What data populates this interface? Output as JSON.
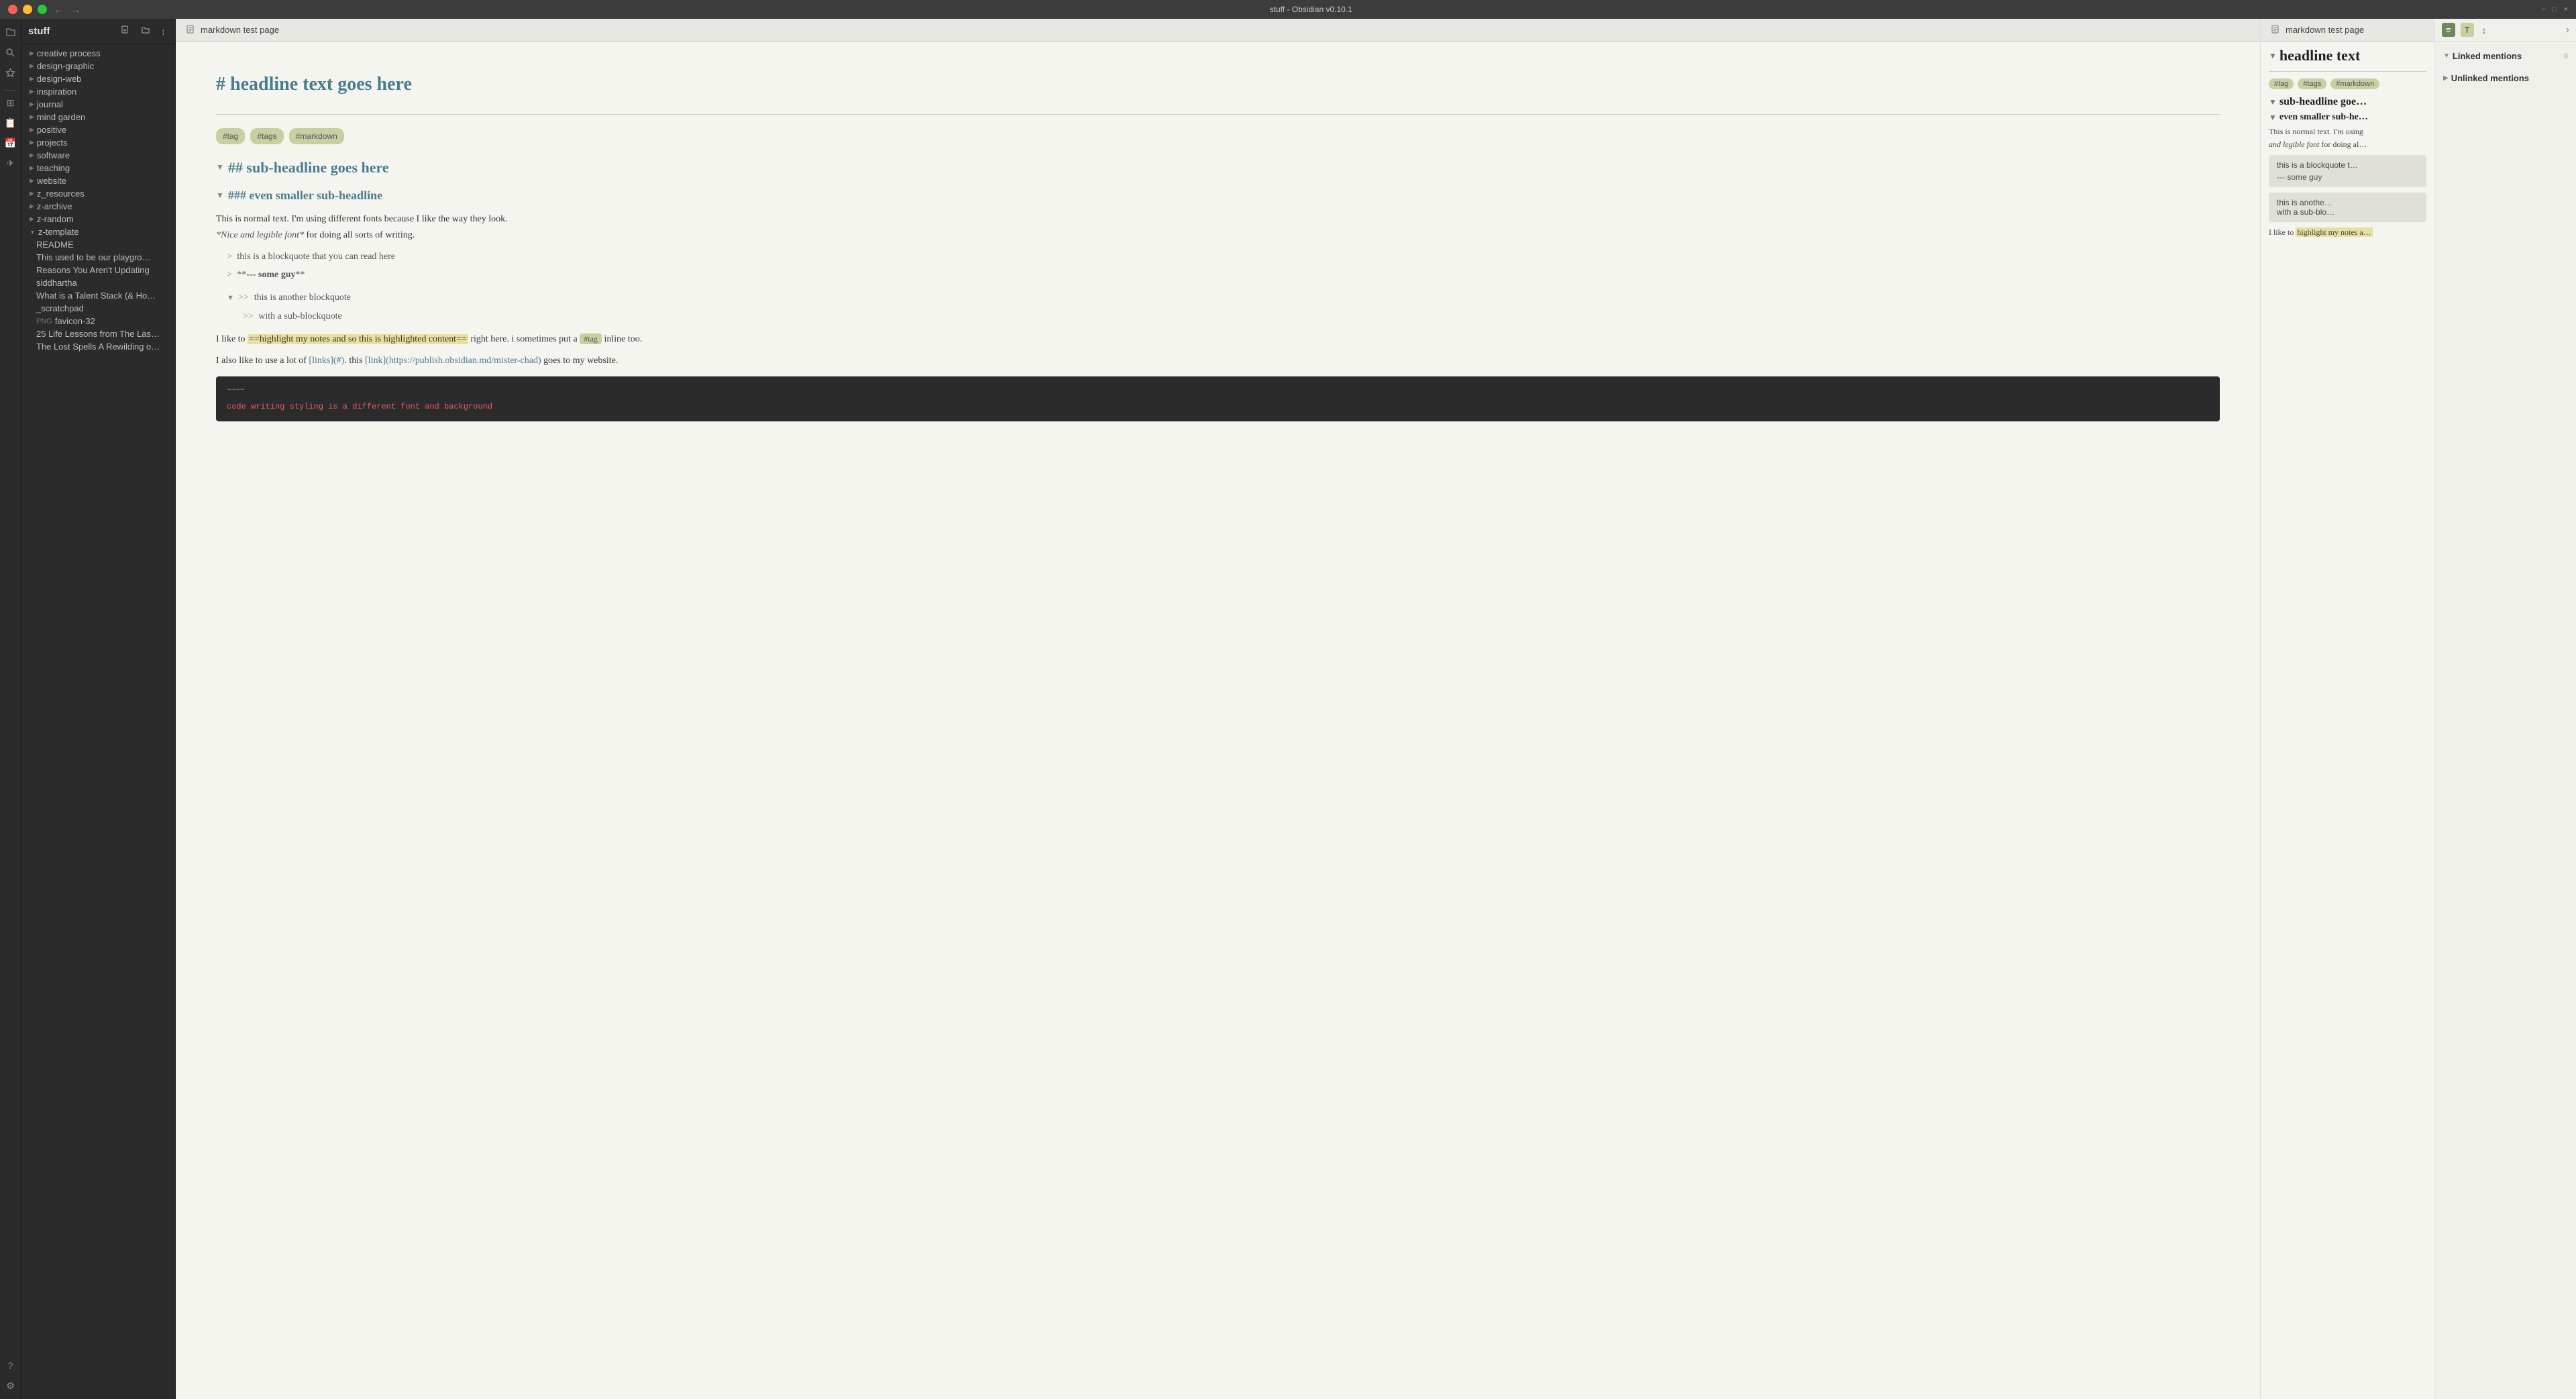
{
  "titlebar": {
    "title": "stuff - Obsidian v0.10.1",
    "back_btn": "←",
    "forward_btn": "→",
    "min_btn": "−",
    "max_btn": "□",
    "close_btn": "×"
  },
  "vault": {
    "name": "stuff"
  },
  "sidebar": {
    "new_file_label": "New file",
    "new_folder_label": "New folder",
    "sort_label": "Sort",
    "items": [
      {
        "label": "creative process",
        "type": "folder"
      },
      {
        "label": "design-graphic",
        "type": "folder"
      },
      {
        "label": "design-web",
        "type": "folder"
      },
      {
        "label": "inspiration",
        "type": "folder"
      },
      {
        "label": "journal",
        "type": "folder"
      },
      {
        "label": "mind garden",
        "type": "folder"
      },
      {
        "label": "positive",
        "type": "folder"
      },
      {
        "label": "projects",
        "type": "folder"
      },
      {
        "label": "software",
        "type": "folder"
      },
      {
        "label": "teaching",
        "type": "folder"
      },
      {
        "label": "website",
        "type": "folder"
      },
      {
        "label": "z_resources",
        "type": "folder"
      },
      {
        "label": "z-archive",
        "type": "folder"
      },
      {
        "label": "z-random",
        "type": "folder"
      },
      {
        "label": "z-template",
        "type": "folder"
      },
      {
        "label": "README",
        "type": "file"
      },
      {
        "label": "This used to be our playgro…",
        "type": "file"
      },
      {
        "label": "Reasons You Aren't Updating",
        "type": "file"
      },
      {
        "label": "siddhartha",
        "type": "file"
      },
      {
        "label": "What is a Talent Stack (& Ho…",
        "type": "file"
      },
      {
        "label": "_scratchpad",
        "type": "file"
      },
      {
        "label": "favicon-32",
        "type": "file",
        "filetype": "png"
      },
      {
        "label": "25 Life Lessons from The Las…",
        "type": "file"
      },
      {
        "label": "The Lost Spells A Rewilding o…",
        "type": "file"
      }
    ]
  },
  "editor": {
    "tab_title": "markdown test page",
    "h1": "# headline text goes here",
    "h1_display": "# headline text goes here",
    "tags": [
      "#tag",
      "#tags",
      "#markdown"
    ],
    "h2": "## sub-headline goes here",
    "h3": "### even smaller sub-headline",
    "para1": "This is normal text. I'm using different fonts because I like the way they look.",
    "para1_italic": "*Nice and legible font*",
    "para1_end": " for doing all sorts of writing.",
    "blockquote1": "this is a blockquote that you can read here",
    "blockquote2": "**--- some guy**",
    "blockquote3": ">> this is another blockquote",
    "blockquote4": ">> with a sub-blockquote",
    "para2_start": "I like to ",
    "para2_highlight": "==highlight my notes and so this is highlighted content==",
    "para2_mid": " right here. i sometimes put a ",
    "para2_tag": "#tag",
    "para2_end": " inline too.",
    "para3_start": "I also like to use a lot of ",
    "para3_link1": "[links](#)",
    "para3_mid": ". this ",
    "para3_link2": "[link](https://publish.obsidian.md/mister-chad)",
    "para3_end": " goes to my website.",
    "code_fence": "~~~~",
    "code_content": "code writing styling is a different font and background"
  },
  "preview": {
    "tab_title": "markdown test page",
    "title": "headline text",
    "tags": [
      "#tag",
      "#tags",
      "#markdown"
    ],
    "h2": "sub-headline goe…",
    "h3": "even smaller sub-he…",
    "para": "This is normal text. I'm using",
    "para_italic": "and legible font",
    "para_end": " for doing all…",
    "blockquote_text": "this is a blockquote t…",
    "blockquote_cite": "--- some guy",
    "blockquote2_text": "this is anothe…",
    "blockquote2_sub": "with a sub-blo…",
    "para2_start": "I like to ",
    "para2_highlight": "highlight my notes a…"
  },
  "right_panel": {
    "btn1": "≡",
    "btn2": "T",
    "sort_icon": "↕",
    "nav_arrow": "›",
    "linked_mentions_title": "Linked mentions",
    "linked_count": "0",
    "unlinked_mentions_title": "Unlinked mentions"
  },
  "rail": {
    "icons": [
      "☰",
      "🔍",
      "⊞",
      "📋",
      "📅",
      "✈",
      "◎",
      "⚙"
    ]
  }
}
